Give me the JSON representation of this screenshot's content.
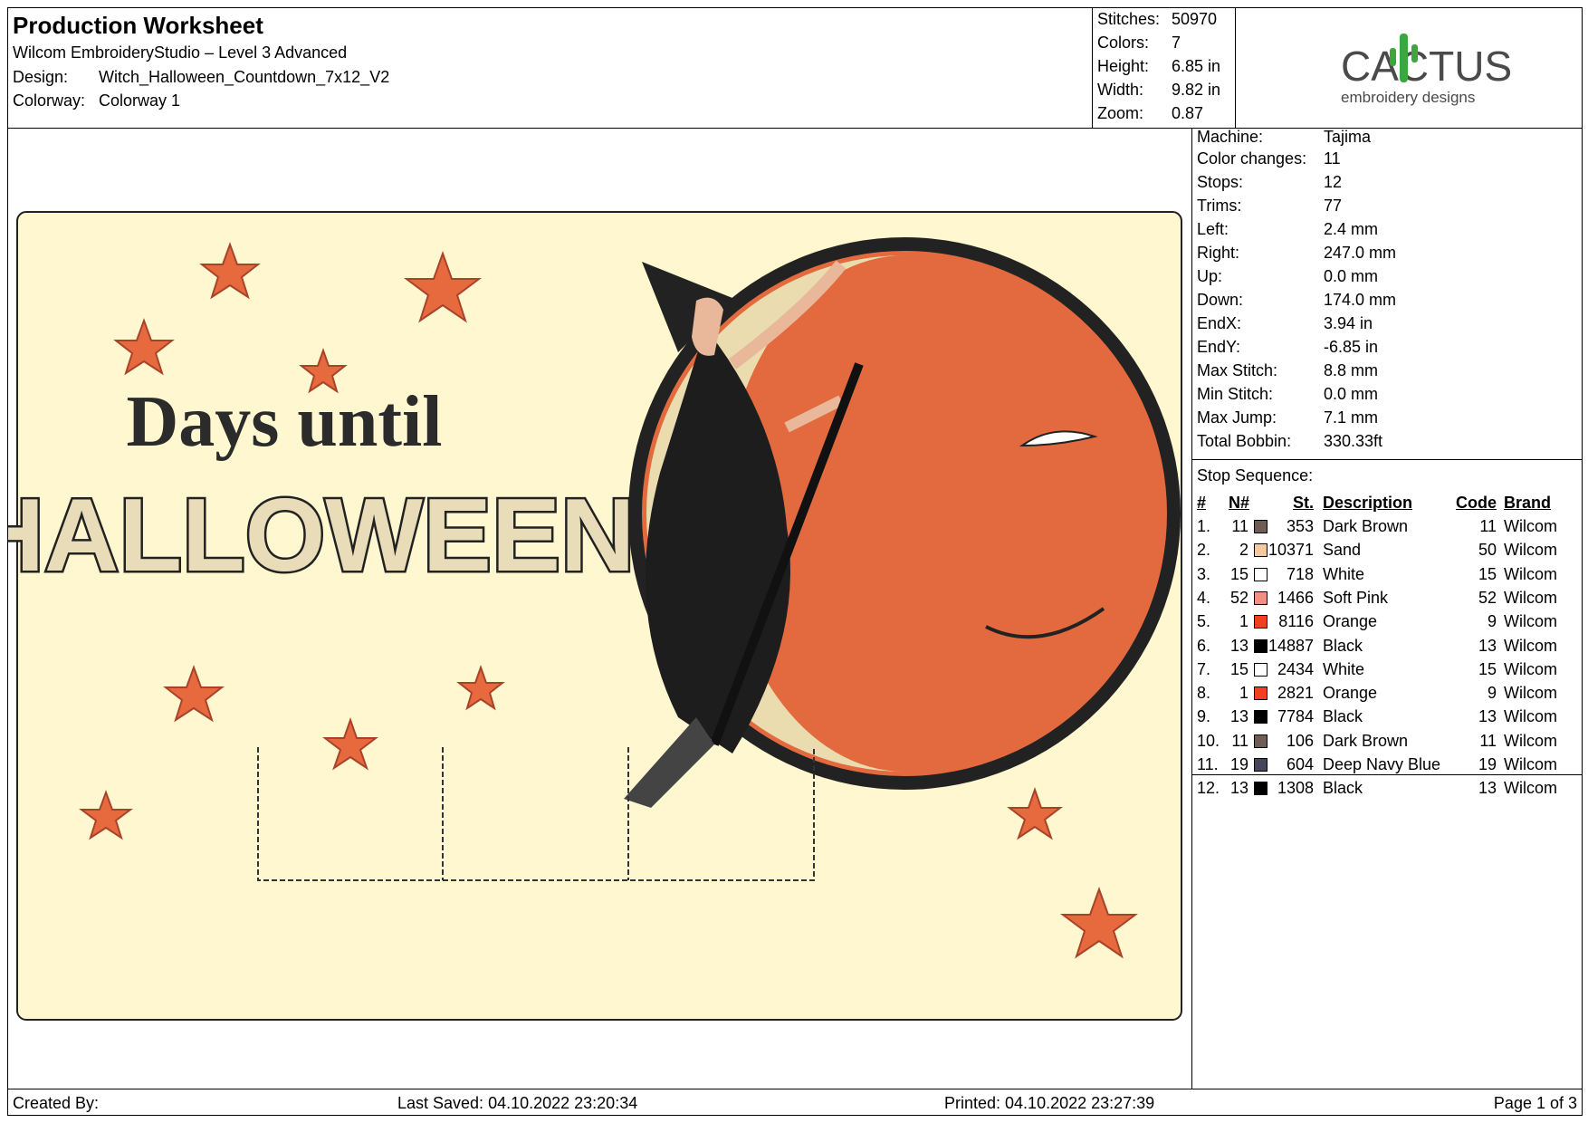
{
  "header": {
    "title": "Production Worksheet",
    "software": "Wilcom EmbroideryStudio – Level 3 Advanced",
    "design_label": "Design:",
    "design_value": "Witch_Halloween_Countdown_7x12_V2",
    "colorway_label": "Colorway:",
    "colorway_value": "Colorway 1"
  },
  "stats": [
    {
      "k": "Stitches:",
      "v": "50970"
    },
    {
      "k": "Colors:",
      "v": "7"
    },
    {
      "k": "Height:",
      "v": "6.85 in"
    },
    {
      "k": "Width:",
      "v": "9.82 in"
    },
    {
      "k": "Zoom:",
      "v": "0.87"
    }
  ],
  "logo": {
    "brand": "CACTUS",
    "tagline": "embroidery designs"
  },
  "design": {
    "line1": "Days until",
    "line2": "HALLOWEEN"
  },
  "machine_info": [
    {
      "k": "Machine:",
      "v": "Tajima"
    },
    {
      "k": "Color changes:",
      "v": "11"
    },
    {
      "k": "Stops:",
      "v": "12"
    },
    {
      "k": "Trims:",
      "v": "77"
    },
    {
      "k": "Left:",
      "v": "2.4 mm"
    },
    {
      "k": "Right:",
      "v": "247.0 mm"
    },
    {
      "k": "Up:",
      "v": "0.0 mm"
    },
    {
      "k": "Down:",
      "v": "174.0 mm"
    },
    {
      "k": "EndX:",
      "v": "3.94 in"
    },
    {
      "k": "EndY:",
      "v": "-6.85 in"
    },
    {
      "k": "Max Stitch:",
      "v": "8.8 mm"
    },
    {
      "k": "Min Stitch:",
      "v": "0.0 mm"
    },
    {
      "k": "Max Jump:",
      "v": "7.1 mm"
    },
    {
      "k": "Total Bobbin:",
      "v": "330.33ft"
    }
  ],
  "stop_sequence": {
    "title": "Stop Sequence:",
    "headers": {
      "num": "#",
      "n": "N#",
      "st": "St.",
      "desc": "Description",
      "code": "Code",
      "brand": "Brand"
    },
    "rows": [
      {
        "num": "1.",
        "n": "11",
        "color": "#6e5d55",
        "st": "353",
        "desc": "Dark Brown",
        "code": "11",
        "brand": "Wilcom"
      },
      {
        "num": "2.",
        "n": "2",
        "color": "#f5c8a0",
        "st": "10371",
        "desc": "Sand",
        "code": "50",
        "brand": "Wilcom"
      },
      {
        "num": "3.",
        "n": "15",
        "color": "#ffffff",
        "st": "718",
        "desc": "White",
        "code": "15",
        "brand": "Wilcom"
      },
      {
        "num": "4.",
        "n": "52",
        "color": "#f09080",
        "st": "1466",
        "desc": "Soft Pink",
        "code": "52",
        "brand": "Wilcom"
      },
      {
        "num": "5.",
        "n": "1",
        "color": "#f04020",
        "st": "8116",
        "desc": "Orange",
        "code": "9",
        "brand": "Wilcom"
      },
      {
        "num": "6.",
        "n": "13",
        "color": "#000000",
        "st": "14887",
        "desc": "Black",
        "code": "13",
        "brand": "Wilcom"
      },
      {
        "num": "7.",
        "n": "15",
        "color": "#ffffff",
        "st": "2434",
        "desc": "White",
        "code": "15",
        "brand": "Wilcom"
      },
      {
        "num": "8.",
        "n": "1",
        "color": "#f04020",
        "st": "2821",
        "desc": "Orange",
        "code": "9",
        "brand": "Wilcom"
      },
      {
        "num": "9.",
        "n": "13",
        "color": "#000000",
        "st": "7784",
        "desc": "Black",
        "code": "13",
        "brand": "Wilcom"
      },
      {
        "num": "10.",
        "n": "11",
        "color": "#6e5d55",
        "st": "106",
        "desc": "Dark Brown",
        "code": "11",
        "brand": "Wilcom"
      },
      {
        "num": "11.",
        "n": "19",
        "color": "#45455a",
        "st": "604",
        "desc": "Deep Navy Blue",
        "code": "19",
        "brand": "Wilcom"
      },
      {
        "num": "12.",
        "n": "13",
        "color": "#000000",
        "st": "1308",
        "desc": "Black",
        "code": "13",
        "brand": "Wilcom"
      }
    ]
  },
  "footer": {
    "created_by": "Created By:",
    "last_saved": "Last Saved: 04.10.2022 23:20:34",
    "printed": "Printed: 04.10.2022 23:27:39",
    "page": "Page 1 of 3"
  }
}
